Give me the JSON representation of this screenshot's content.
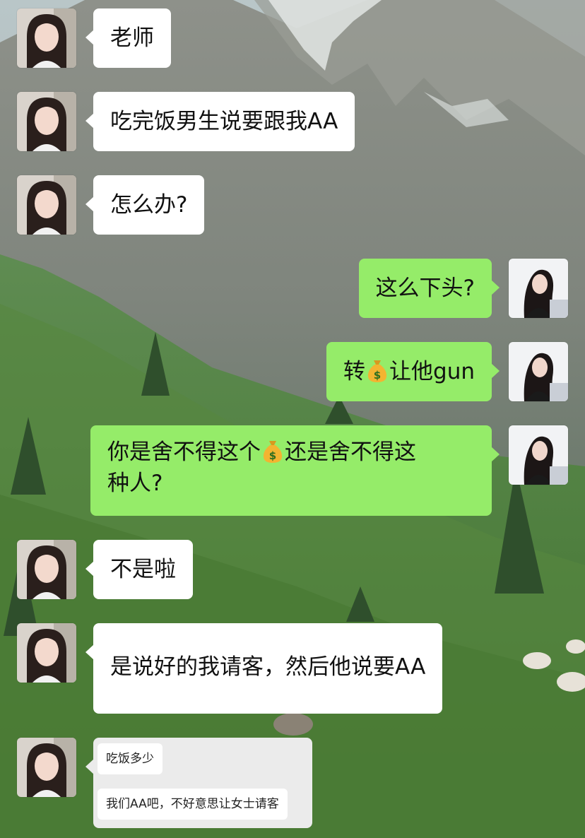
{
  "conversation": {
    "messages": [
      {
        "side": "left",
        "text": "老师"
      },
      {
        "side": "left",
        "text": "吃完饭男生说要跟我AA"
      },
      {
        "side": "left",
        "text": "怎么办?"
      },
      {
        "side": "right",
        "text": "这么下头?"
      },
      {
        "side": "right",
        "before": "转",
        "icon": "money-bag-icon",
        "after": "让他gun"
      },
      {
        "side": "right",
        "before": "你是舍不得这个",
        "icon": "money-bag-icon",
        "after": "还是舍不得这\n种人?"
      },
      {
        "side": "left",
        "text": "不是啦"
      },
      {
        "side": "left",
        "text": "是说好的我请客，然后他说要AA"
      }
    ],
    "screenshot": {
      "msg1": "吃饭多少",
      "msg2": "我们AA吧，不好意思让女士请客"
    }
  },
  "colors": {
    "sent_bubble": "#95ec69",
    "received_bubble": "#ffffff"
  }
}
